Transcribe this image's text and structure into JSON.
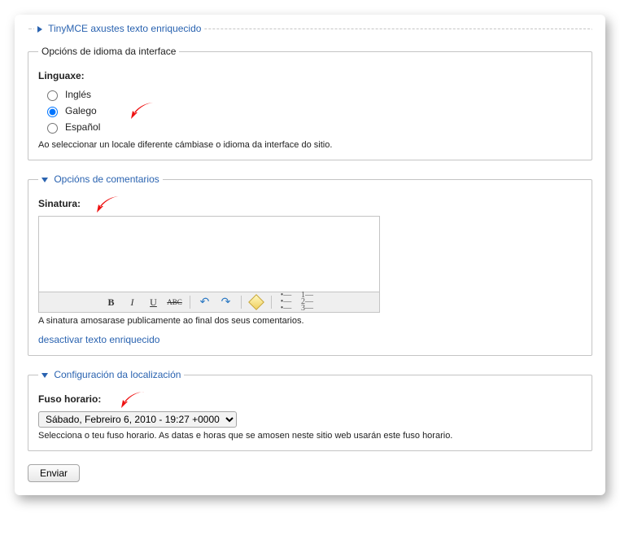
{
  "collapsed": {
    "tinymce": "TinyMCE axustes texto enriquecido"
  },
  "lang_section": {
    "legend": "Opcións de idioma da interface",
    "label": "Linguaxe:",
    "options": [
      "Inglés",
      "Galego",
      "Español"
    ],
    "selected_index": 1,
    "help": "Ao seleccionar un locale diferente cámbiase o idioma da interface do sitio."
  },
  "comments_section": {
    "legend": "Opcións de comentarios",
    "signature_label": "Sinatura:",
    "signature_help": "A sinatura amosarase publicamente ao final dos seus comentarios.",
    "disable_rte": "desactivar texto enriquecido",
    "toolbar": {
      "bold": "B",
      "italic": "I",
      "underline": "U",
      "strike": "ABC",
      "undo": "↶",
      "redo": "↷",
      "ul": "≣",
      "ol": "≣"
    }
  },
  "tz_section": {
    "legend": "Configuración da localización",
    "label": "Fuso horario:",
    "selected": "Sábado, Febreiro 6, 2010 - 19:27 +0000",
    "help": "Selecciona o teu fuso horario. As datas e horas que se amosen neste sitio web usarán este fuso horario."
  },
  "submit": "Enviar"
}
